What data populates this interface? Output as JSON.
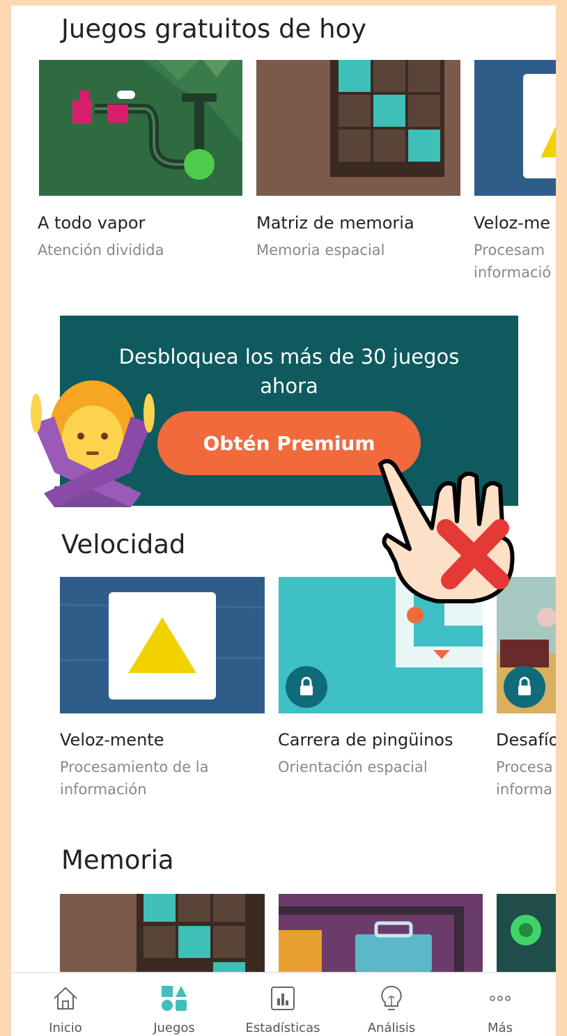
{
  "sections": {
    "free_today": "Juegos gratuitos de hoy",
    "speed": "Velocidad",
    "memory": "Memoria"
  },
  "free_games": [
    {
      "title": "A todo vapor",
      "category": "Atención dividida"
    },
    {
      "title": "Matriz de memoria",
      "category": "Memoria espacial"
    },
    {
      "title": "Veloz-me",
      "category_line1": "Procesam",
      "category_line2": "informació"
    }
  ],
  "banner": {
    "line1": "Desbloquea los más de 30 juegos",
    "line2": "ahora",
    "button": "Obtén Premium"
  },
  "speed_games": [
    {
      "title": "Veloz-mente",
      "category_line1": "Procesamiento de la",
      "category_line2": "información",
      "locked": false
    },
    {
      "title": "Carrera de pingüinos",
      "category": "Orientación espacial",
      "locked": true
    },
    {
      "title": "Desafío",
      "category_line1": "Procesa",
      "category_line2": "informa",
      "locked": true
    }
  ],
  "tabs": [
    {
      "label": "Inicio",
      "icon": "home-icon"
    },
    {
      "label": "Juegos",
      "icon": "games-icon",
      "active": true
    },
    {
      "label": "Estadísticas",
      "icon": "stats-icon"
    },
    {
      "label": "Análisis",
      "icon": "lightbulb-icon"
    },
    {
      "label": "Más",
      "icon": "more-icon"
    }
  ],
  "colors": {
    "accent": "#3ec0b8",
    "banner": "#0e5a5e",
    "premium_button": "#f06a3c",
    "lock": "#0f6b78",
    "border": "#fcd9b3"
  },
  "overlays": [
    "woman-crossed-arms-emoji",
    "hand-with-red-x-icon"
  ]
}
